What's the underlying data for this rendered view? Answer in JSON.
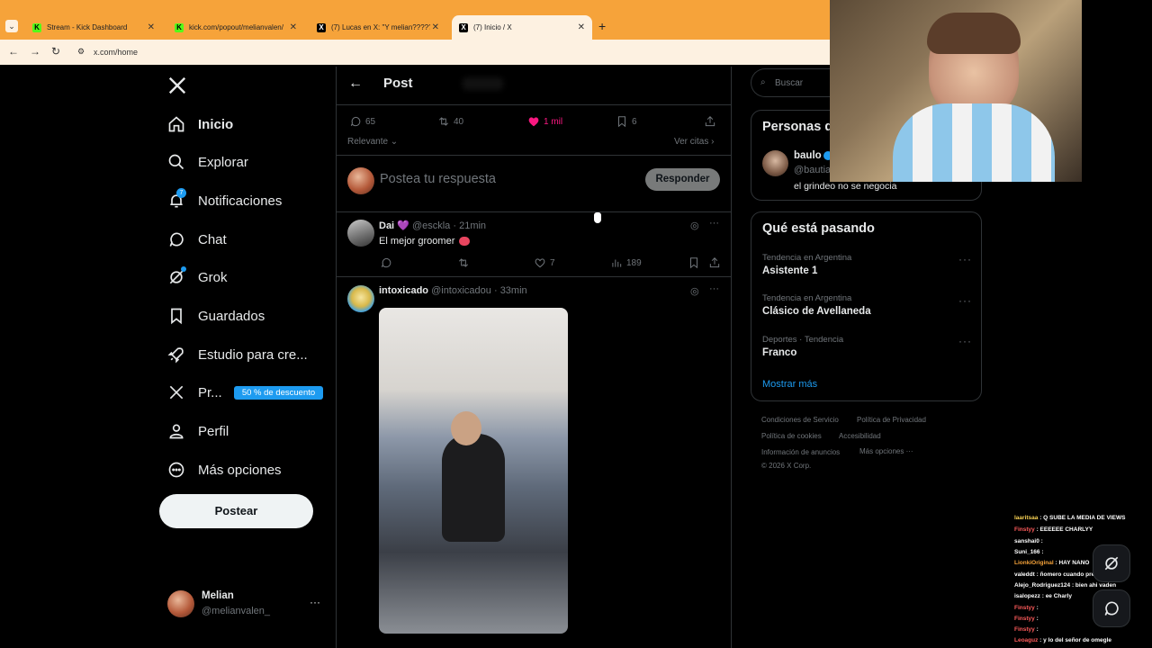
{
  "browser": {
    "tabs": [
      {
        "title": "Stream - Kick Dashboard",
        "icon": "kick-icon"
      },
      {
        "title": "kick.com/popout/melianvalen/",
        "icon": "kick-icon"
      },
      {
        "title": "(7) Lucas en X: \"Y melian?????",
        "icon": "x-icon"
      },
      {
        "title": "(7) Inicio / X",
        "icon": "x-icon"
      }
    ],
    "new_tab": "+",
    "url": "x.com/home"
  },
  "sidebar": {
    "items": [
      {
        "label": "Inicio",
        "icon": "home-icon"
      },
      {
        "label": "Explorar",
        "icon": "search-icon"
      },
      {
        "label": "Notificaciones",
        "icon": "bell-icon",
        "badge": "7"
      },
      {
        "label": "Chat",
        "icon": "chat-icon"
      },
      {
        "label": "Grok",
        "icon": "grok-icon"
      },
      {
        "label": "Guardados",
        "icon": "bookmark-icon"
      },
      {
        "label": "Estudio para cre...",
        "icon": "rocket-icon"
      },
      {
        "label": "Pr...",
        "icon": "x-logo-icon"
      },
      {
        "label": "Perfil",
        "icon": "person-icon"
      },
      {
        "label": "Más opciones",
        "icon": "more-circle-icon"
      }
    ],
    "premium_badge": "50 % de descuento",
    "post_button": "Postear",
    "account": {
      "name": "Melian",
      "handle": "@melianvalen_",
      "menu": "···"
    }
  },
  "main": {
    "header_title": "Post",
    "post_stats": {
      "replies": "65",
      "reposts": "40",
      "likes": "1 mil",
      "bookmarks": "6"
    },
    "sort_label": "Relevante",
    "quotes_link": "Ver citas",
    "reply_placeholder": "Postea tu respuesta",
    "reply_button": "Responder",
    "replies": [
      {
        "name": "Dai 💜",
        "handle": "@esckla",
        "time": "· 21min",
        "text": "El mejor groomer",
        "views": "189",
        "likes": "7"
      },
      {
        "name": "intoxicado",
        "handle": "@intoxicadou",
        "time": "· 33min",
        "text": ""
      }
    ]
  },
  "right": {
    "search_placeholder": "Buscar",
    "who_to_follow": {
      "title": "Personas q",
      "name": "baulo",
      "handle": "@bautia",
      "bio": "el grindeo no se negocia"
    },
    "trends": {
      "title": "Qué está pasando",
      "items": [
        {
          "context": "Tendencia en Argentina",
          "name": "Asistente 1"
        },
        {
          "context": "Tendencia en Argentina",
          "name": "Clásico de Avellaneda"
        },
        {
          "context": "Deportes · Tendencia",
          "name": "Franco"
        }
      ],
      "show_more": "Mostrar más"
    },
    "footer": {
      "l1": [
        "Condiciones de Servicio",
        "Política de Privacidad"
      ],
      "l2": [
        "Política de cookies",
        "Accesibilidad"
      ],
      "l3": [
        "Información de anuncios",
        "Más opciones ···"
      ],
      "copyright": "© 2026 X Corp."
    }
  },
  "chat_overlay": {
    "messages": [
      {
        "user": "laaritsaa",
        "text": "Q SUBE LA MEDIA DE VIEWS",
        "color": "#f7d154"
      },
      {
        "user": "Finstyy",
        "text": "EEEEEE CHARLYY",
        "color": "#ff5b5b"
      },
      {
        "user": "sanshai0",
        "text": "",
        "color": "#e7e9ea"
      },
      {
        "user": "Suni_166",
        "text": "",
        "color": "#e7e9ea"
      },
      {
        "user": "LionkiOriginal",
        "text": "HAY NANO",
        "color": "#f6a33a"
      },
      {
        "user": "valeddt",
        "text": "ñomero cuando prende morte",
        "color": "#e7e9ea"
      },
      {
        "user": "Alejo_Rodriguez124",
        "text": "bien ahi vaden",
        "color": "#e7e9ea"
      },
      {
        "user": "isalopezz",
        "text": "ee Charly",
        "color": "#e7e9ea"
      },
      {
        "user": "Finstyy",
        "text": "",
        "color": "#ff5b5b"
      },
      {
        "user": "Finstyy",
        "text": "",
        "color": "#ff5b5b"
      },
      {
        "user": "Finstyy",
        "text": "",
        "color": "#ff5b5b"
      },
      {
        "user": "Leoaguz",
        "text": "y lo del señor de omegle",
        "color": "#ff5b5b"
      }
    ]
  },
  "colors": {
    "accent": "#1d9bf0",
    "like": "#f91880",
    "tabbar": "#f6a33a"
  }
}
